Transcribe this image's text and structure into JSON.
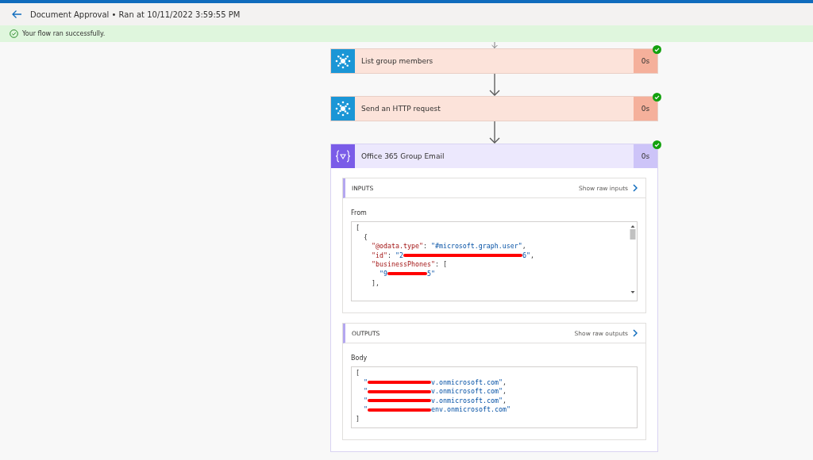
{
  "header": {
    "title": "Document Approval • Ran at 10/11/2022 3:59:55 PM"
  },
  "status_bar": {
    "message": "Your flow ran successfully."
  },
  "steps": [
    {
      "kind": "connector",
      "title": "List group members",
      "duration": "0s",
      "succeeded": true,
      "expanded": false
    },
    {
      "kind": "connector",
      "title": "Send an HTTP request",
      "duration": "0s",
      "succeeded": true,
      "expanded": false
    },
    {
      "kind": "variable",
      "title": "Office 365 Group Email",
      "duration": "0s",
      "succeeded": true,
      "expanded": true,
      "panels": [
        {
          "title": "INPUTS",
          "link": "Show raw inputs",
          "field_label": "From",
          "scrollable": true,
          "lines": [
            [
              {
                "kind": "plain",
                "text": "["
              }
            ],
            [
              {
                "kind": "plain",
                "text": "{"
              }
            ],
            [
              {
                "kind": "key",
                "text": "\"@odata.type\""
              },
              {
                "kind": "plain",
                "text": ": "
              },
              {
                "kind": "string",
                "text": "\"#microsoft.graph.user\""
              },
              {
                "kind": "plain",
                "text": ","
              }
            ],
            [
              {
                "kind": "key",
                "text": "\"id\""
              },
              {
                "kind": "plain",
                "text": ": "
              },
              {
                "kind": "string",
                "text": "\"2"
              },
              {
                "kind": "redacted"
              },
              {
                "kind": "string",
                "text": "6\""
              },
              {
                "kind": "plain",
                "text": ","
              }
            ],
            [
              {
                "kind": "key",
                "text": "\"businessPhones\""
              },
              {
                "kind": "plain",
                "text": ": ["
              }
            ],
            [
              {
                "kind": "string",
                "text": "\"9"
              },
              {
                "kind": "redacted"
              },
              {
                "kind": "string",
                "text": "5\""
              }
            ],
            [
              {
                "kind": "plain",
                "text": "],"
              }
            ]
          ]
        },
        {
          "title": "OUTPUTS",
          "link": "Show raw outputs",
          "field_label": "Body",
          "scrollable": false,
          "lines": [
            [
              {
                "kind": "plain",
                "text": "["
              }
            ],
            [
              {
                "kind": "string",
                "text": "\""
              },
              {
                "kind": "redacted"
              },
              {
                "kind": "string",
                "text": "v.onmicrosoft.com\""
              },
              {
                "kind": "plain",
                "text": ","
              }
            ],
            [
              {
                "kind": "string",
                "text": "\""
              },
              {
                "kind": "redacted"
              },
              {
                "kind": "string",
                "text": "v.onmicrosoft.com\""
              },
              {
                "kind": "plain",
                "text": ","
              }
            ],
            [
              {
                "kind": "string",
                "text": "\""
              },
              {
                "kind": "redacted"
              },
              {
                "kind": "string",
                "text": "v.onmicrosoft.com\""
              },
              {
                "kind": "plain",
                "text": ","
              }
            ],
            [
              {
                "kind": "string",
                "text": "\""
              },
              {
                "kind": "redacted"
              },
              {
                "kind": "string",
                "text": "env.onmicrosoft.com\""
              }
            ],
            [
              {
                "kind": "plain",
                "text": "]"
              }
            ]
          ]
        }
      ]
    }
  ]
}
